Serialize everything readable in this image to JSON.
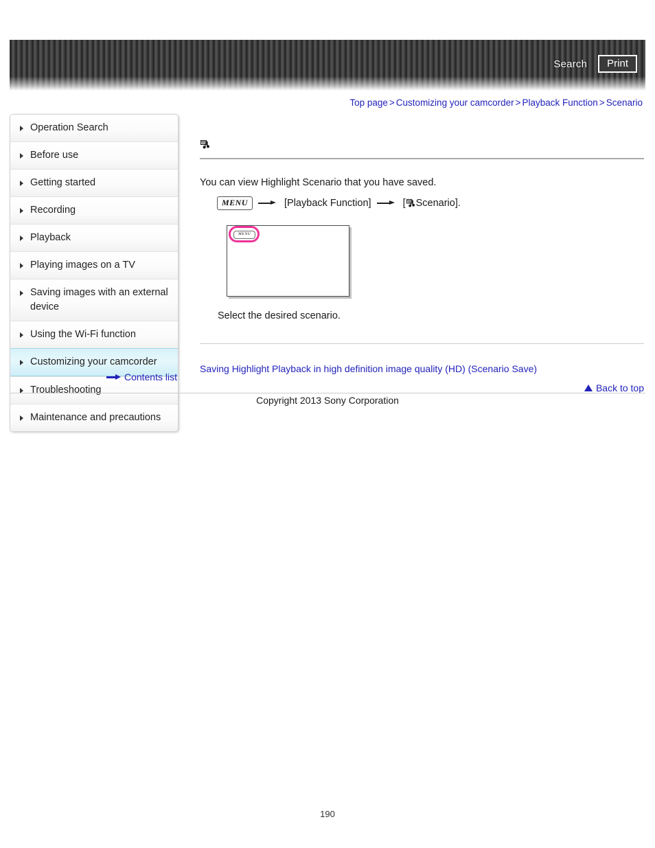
{
  "header": {
    "search_label": "Search",
    "print_label": "Print"
  },
  "breadcrumb": {
    "items": [
      {
        "label": "Top page"
      },
      {
        "label": "Customizing your camcorder"
      },
      {
        "label": "Playback Function"
      },
      {
        "label": "Scenario"
      }
    ],
    "separator": ">"
  },
  "sidebar": {
    "items": [
      {
        "label": "Operation Search",
        "selected": false
      },
      {
        "label": "Before use",
        "selected": false
      },
      {
        "label": "Getting started",
        "selected": false
      },
      {
        "label": "Recording",
        "selected": false
      },
      {
        "label": "Playback",
        "selected": false
      },
      {
        "label": "Playing images on a TV",
        "selected": false
      },
      {
        "label": "Saving images with an external device",
        "selected": false
      },
      {
        "label": "Using the Wi-Fi function",
        "selected": false
      },
      {
        "label": "Customizing your camcorder",
        "selected": true
      },
      {
        "label": "Troubleshooting",
        "selected": false
      },
      {
        "label": "Maintenance and precautions",
        "selected": false
      }
    ],
    "contents_list_label": "Contents list"
  },
  "main": {
    "title_icon": "highlight-scenario-icon",
    "title": "",
    "intro": "You can view Highlight Scenario that you have saved.",
    "menu_path": {
      "menu_label": "MENU",
      "step1": "[Playback Function]",
      "step2_prefix": "[",
      "step2_label": "Scenario].",
      "arrow": "→"
    },
    "illustration": {
      "menu_button_label": "MENU",
      "highlight_color": "#ee3399"
    },
    "caption": "Select the desired scenario.",
    "related_link": "Saving Highlight Playback in high definition image quality (HD) (Scenario Save)",
    "back_to_top": "Back to top"
  },
  "footer": {
    "copyright": "Copyright 2013 Sony Corporation",
    "page_number": "190"
  },
  "colors": {
    "link": "#2222bb",
    "selected_nav": "#d7f2fa",
    "highlight_pink": "#ee3399"
  }
}
